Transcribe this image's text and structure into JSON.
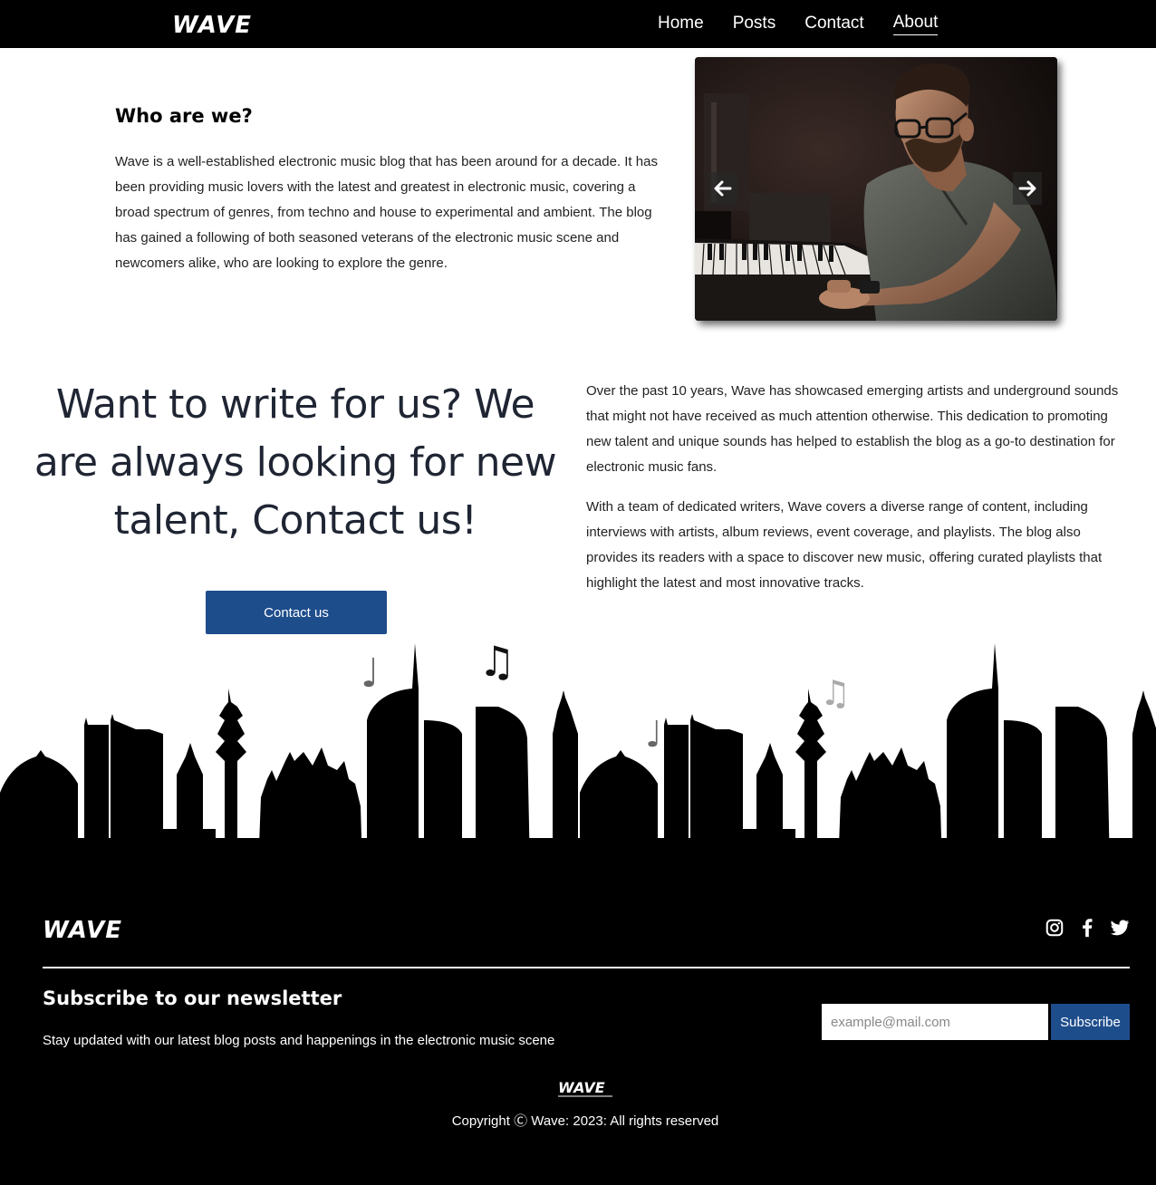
{
  "nav": {
    "logo": "WAVE",
    "links": [
      {
        "label": "Home",
        "active": false
      },
      {
        "label": "Posts",
        "active": false
      },
      {
        "label": "Contact",
        "active": false
      },
      {
        "label": "About",
        "active": true
      }
    ]
  },
  "about": {
    "title": "Who are we?",
    "text": "Wave is a well-established electronic music blog that has been around for a decade. It has been providing music lovers with the latest and greatest in electronic music, covering a broad spectrum of genres, from techno and house to experimental and ambient. The blog has gained a following of both seasoned veterans of the electronic music scene and newcomers alike, who are looking to explore the genre."
  },
  "carousel": {
    "prev_icon": "arrow-left-icon",
    "next_icon": "arrow-right-icon"
  },
  "write": {
    "heading": "Want to write for us? We are always looking for new talent, Contact us!",
    "button_label": "Contact us",
    "paragraph_1": "Over the past 10 years, Wave has showcased emerging artists and underground sounds that might not have received as much attention otherwise. This dedication to promoting new talent and unique sounds has helped to establish the blog as a go-to destination for electronic music fans.",
    "paragraph_2": "With a team of dedicated writers, Wave covers a diverse range of content, including interviews with artists, album reviews, event coverage, and playlists. The blog also provides its readers with a space to discover new music, offering curated playlists that highlight the latest and most innovative tracks."
  },
  "footer": {
    "logo": "WAVE",
    "social": [
      "instagram-icon",
      "facebook-icon",
      "twitter-icon"
    ],
    "newsletter_title": "Subscribe to our newsletter",
    "newsletter_subtitle": "Stay updated with our latest blog posts and happenings in the electronic music scene",
    "email_placeholder": "example@mail.com",
    "subscribe_label": "Subscribe",
    "small_logo": "WAVE",
    "copyright": "Copyright Ⓒ Wave: 2023: All rights reserved"
  },
  "colors": {
    "nav_bg": "#000000",
    "accent": "#1e4d8c",
    "heading_text": "#1f2533",
    "footer_bg": "#000000"
  }
}
